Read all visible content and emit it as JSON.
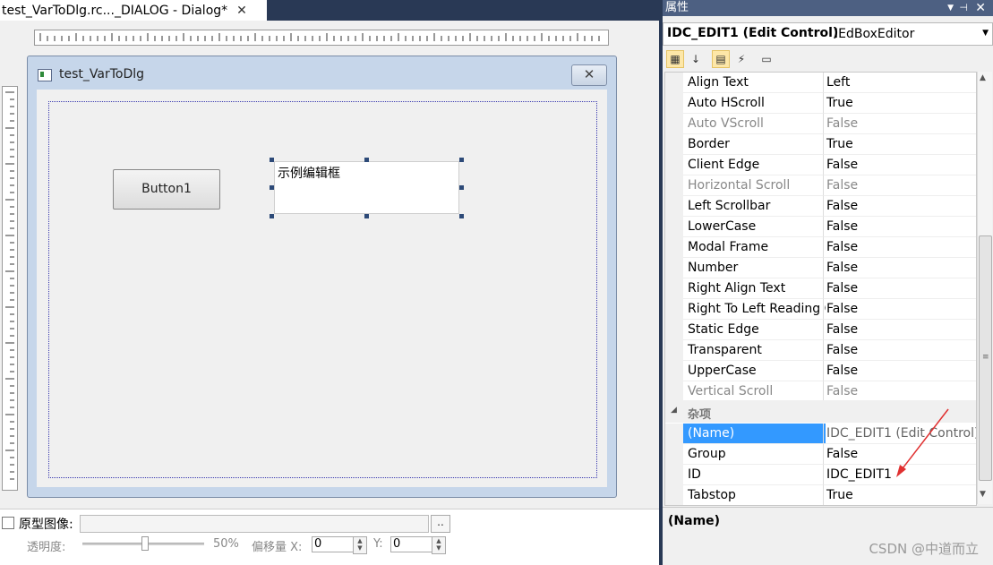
{
  "editor": {
    "tab_title": "test_VarToDlg.rc..._DIALOG - Dialog*",
    "tab_close": "✕",
    "dialog": {
      "title": "test_VarToDlg",
      "close_glyph": "✕",
      "button_label": "Button1",
      "edit_text": "示例编辑框"
    },
    "bottom": {
      "prototype_label": "原型图像:",
      "browse_label": "..",
      "opacity_label": "透明度:",
      "opacity_value_text": "50%",
      "opacity": 0.5,
      "offset_label": "偏移量 X:",
      "x_value": "0",
      "y_label": "Y:",
      "y_value": "0"
    }
  },
  "properties": {
    "title": "属性",
    "object_name": "IDC_EDIT1 (Edit Control)",
    "object_type": "IEdBoxEditor",
    "rows": [
      {
        "name": "Align Text",
        "value": "Left",
        "dim": false
      },
      {
        "name": "Auto HScroll",
        "value": "True",
        "dim": false
      },
      {
        "name": "Auto VScroll",
        "value": "False",
        "dim": true
      },
      {
        "name": "Border",
        "value": "True",
        "dim": false
      },
      {
        "name": "Client Edge",
        "value": "False",
        "dim": false
      },
      {
        "name": "Horizontal Scroll",
        "value": "False",
        "dim": true
      },
      {
        "name": "Left Scrollbar",
        "value": "False",
        "dim": false
      },
      {
        "name": "LowerCase",
        "value": "False",
        "dim": false
      },
      {
        "name": "Modal Frame",
        "value": "False",
        "dim": false
      },
      {
        "name": "Number",
        "value": "False",
        "dim": false
      },
      {
        "name": "Right Align Text",
        "value": "False",
        "dim": false
      },
      {
        "name": "Right To Left Reading Order",
        "value": "False",
        "dim": false
      },
      {
        "name": "Static Edge",
        "value": "False",
        "dim": false
      },
      {
        "name": "Transparent",
        "value": "False",
        "dim": false
      },
      {
        "name": "UpperCase",
        "value": "False",
        "dim": false
      },
      {
        "name": "Vertical Scroll",
        "value": "False",
        "dim": true
      }
    ],
    "category": "杂项",
    "misc_rows": [
      {
        "name": "(Name)",
        "value": "IDC_EDIT1 (Edit Control)",
        "selected": true
      },
      {
        "name": "Group",
        "value": "False"
      },
      {
        "name": "ID",
        "value": "IDC_EDIT1"
      },
      {
        "name": "Tabstop",
        "value": "True"
      }
    ],
    "description_title": "(Name)"
  },
  "watermark": "CSDN @中道而立",
  "colors": {
    "selection": "#3399ff",
    "titlebar": "#4d6082",
    "annotation_arrow": "#e03030"
  }
}
